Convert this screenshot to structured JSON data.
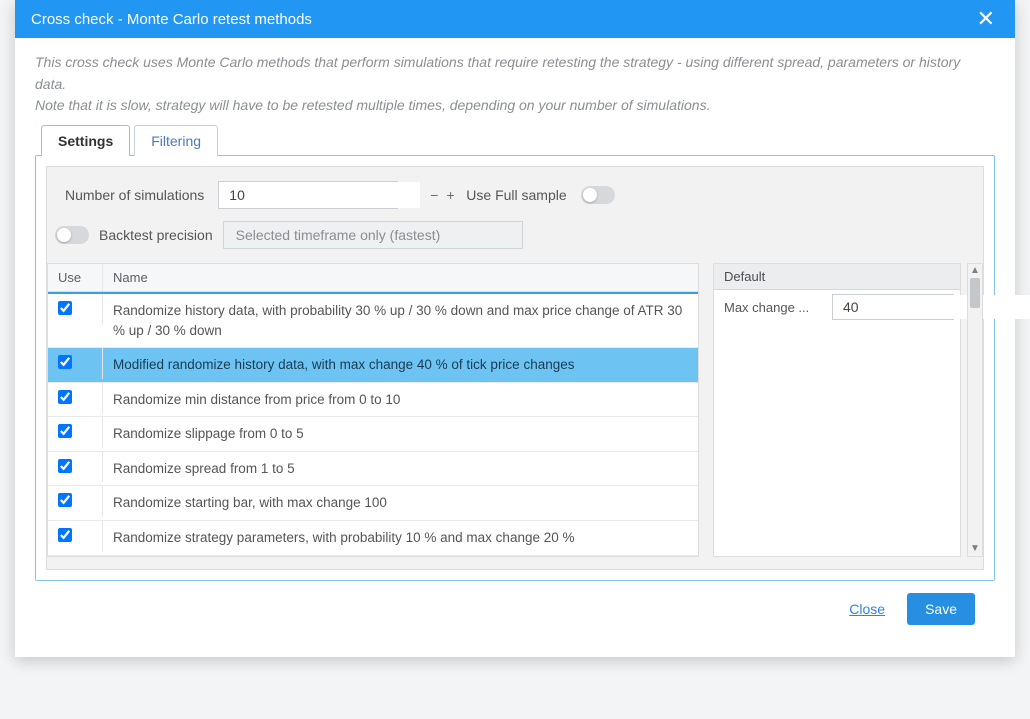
{
  "title": "Cross check - Monte Carlo retest methods",
  "intro_line1": "This cross check uses Monte Carlo methods that perform simulations that require retesting the strategy - using different spread, parameters or history data.",
  "intro_line2": "Note that it is slow, strategy will have to be retested multiple times, depending on your number of simulations.",
  "tabs": {
    "settings": "Settings",
    "filtering": "Filtering",
    "active": "settings"
  },
  "controls": {
    "num_sim_label": "Number of simulations",
    "num_sim_value": "10",
    "use_full_sample_label": "Use Full sample",
    "use_full_sample_on": false,
    "backtest_precision_label": "Backtest precision",
    "backtest_precision_on": false,
    "backtest_precision_value": "Selected timeframe only (fastest)"
  },
  "grid": {
    "col_use": "Use",
    "col_name": "Name",
    "selected_index": 1,
    "rows": [
      {
        "use": true,
        "name": "Randomize history data, with probability 30 % up / 30 % down and max price change of ATR 30 % up / 30 % down"
      },
      {
        "use": true,
        "name": "Modified randomize history data, with max change 40 % of tick price changes"
      },
      {
        "use": true,
        "name": "Randomize min distance from price from 0 to 10"
      },
      {
        "use": true,
        "name": "Randomize slippage from 0 to 5"
      },
      {
        "use": true,
        "name": "Randomize spread from 1 to 5"
      },
      {
        "use": true,
        "name": "Randomize starting bar, with max change 100"
      },
      {
        "use": true,
        "name": "Randomize strategy parameters, with probability 10 % and max change 20 %"
      }
    ]
  },
  "params": {
    "header": "Default",
    "items": [
      {
        "label": "Max change ...",
        "value": "40"
      }
    ]
  },
  "footer": {
    "close": "Close",
    "save": "Save"
  }
}
